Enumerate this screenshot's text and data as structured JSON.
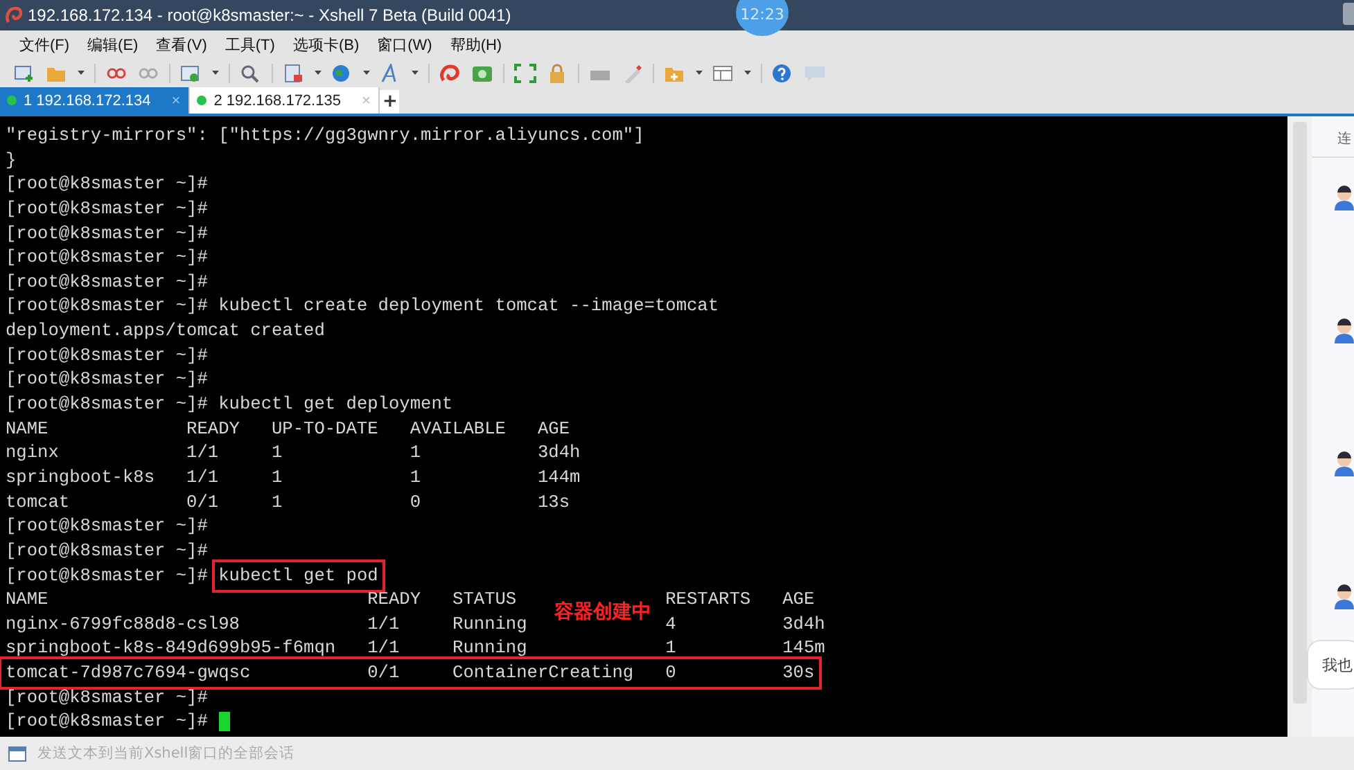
{
  "window": {
    "title": "192.168.172.134 - root@k8smaster:~ - Xshell 7 Beta (Build 0041)",
    "clock": "12:23"
  },
  "menu": [
    "文件(F)",
    "编辑(E)",
    "查看(V)",
    "工具(T)",
    "选项卡(B)",
    "窗口(W)",
    "帮助(H)"
  ],
  "tabs": [
    {
      "label": "1 192.168.172.134",
      "close": "×",
      "connected": true,
      "selected": true
    },
    {
      "label": "2 192.168.172.135",
      "close": "×",
      "connected": true,
      "selected": false
    }
  ],
  "new_tab": "+",
  "terminal": {
    "lines": [
      {
        "text": "\"registry-mirrors\": [\"https://gg3gwnry.mirror.aliyuncs.com\"]"
      },
      {
        "text": "}"
      },
      {
        "prompt": "[root@k8smaster ~]#"
      },
      {
        "prompt": "[root@k8smaster ~]#"
      },
      {
        "prompt": "[root@k8smaster ~]#"
      },
      {
        "prompt": "[root@k8smaster ~]#"
      },
      {
        "prompt": "[root@k8smaster ~]#"
      },
      {
        "prompt": "[root@k8smaster ~]#",
        "command": "kubectl create deployment tomcat --image=tomcat"
      },
      {
        "text": "deployment.apps/tomcat created"
      },
      {
        "prompt": "[root@k8smaster ~]#"
      },
      {
        "prompt": "[root@k8smaster ~]#"
      },
      {
        "prompt": "[root@k8smaster ~]#",
        "command": "kubectl get deployment"
      },
      {
        "text": "NAME             READY   UP-TO-DATE   AVAILABLE   AGE"
      },
      {
        "text": "nginx            1/1     1            1           3d4h"
      },
      {
        "text": "springboot-k8s   1/1     1            1           144m"
      },
      {
        "text": "tomcat           0/1     1            0           13s"
      },
      {
        "prompt": "[root@k8smaster ~]#"
      },
      {
        "prompt": "[root@k8smaster ~]#"
      },
      {
        "prompt": "[root@k8smaster ~]#",
        "command": "kubectl get pod",
        "boxed": true
      },
      {
        "text": "NAME                              READY   STATUS              RESTARTS   AGE"
      },
      {
        "text": "nginx-6799fc88d8-csl98            1/1     Running             4          3d4h",
        "note": "容器创建中"
      },
      {
        "text": "springboot-k8s-849d699b95-f6mqn   1/1     Running             1          145m"
      },
      {
        "text": "tomcat-7d987c7694-gwqsc           0/1     ContainerCreating   0          30s",
        "boxed": true
      },
      {
        "prompt": "[root@k8smaster ~]#"
      },
      {
        "prompt": "[root@k8smaster ~]#",
        "cursor": true
      }
    ]
  },
  "side_panel": {
    "header": "连",
    "bubble": "我也"
  },
  "status_bar": {
    "text": "发送文本到当前Xshell窗口的全部会话"
  }
}
